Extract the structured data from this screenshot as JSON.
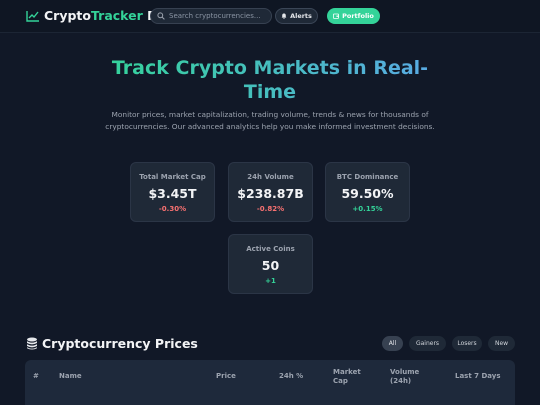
{
  "header": {
    "logo_main": "Crypto",
    "logo_accent": "Tracker",
    "logo_suffix": " Pro",
    "search_placeholder": "Search cryptocurrencies...",
    "alerts_label": "Alerts",
    "portfolio_label": "Portfolio"
  },
  "hero": {
    "title_line1": "Track Crypto Markets in Real-",
    "title_line2": "Time",
    "subtitle": "Monitor prices, market capitalization, trading volume, trends & news for thousands of cryptocurrencies. Our advanced analytics help you make informed investment decisions."
  },
  "stats": [
    {
      "label": "Total Market Cap",
      "value": "$3.45T",
      "change": "-0.30%"
    },
    {
      "label": "24h Volume",
      "value": "$238.87B",
      "change": "-0.82%"
    },
    {
      "label": "BTC Dominance",
      "value": "59.50%",
      "change": "+0.15%"
    },
    {
      "label": "Active Coins",
      "value": "50",
      "change": "+1"
    }
  ],
  "prices": {
    "title": "Cryptocurrency Prices",
    "filters": [
      "All",
      "Gainers",
      "Losers",
      "New"
    ],
    "active_filter": "All",
    "columns": {
      "rank": "#",
      "name": "Name",
      "price": "Price",
      "change": "24h %",
      "market_cap_1": "Market",
      "market_cap_2": "Cap",
      "volume_1": "Volume",
      "volume_2": "(24h)",
      "last7": "Last 7 Days"
    }
  },
  "colors": {
    "background": "#111827",
    "accent_green": "#34d399",
    "accent_blue": "#5aa9e6",
    "negative": "#f87171",
    "card": "#1f2937"
  }
}
